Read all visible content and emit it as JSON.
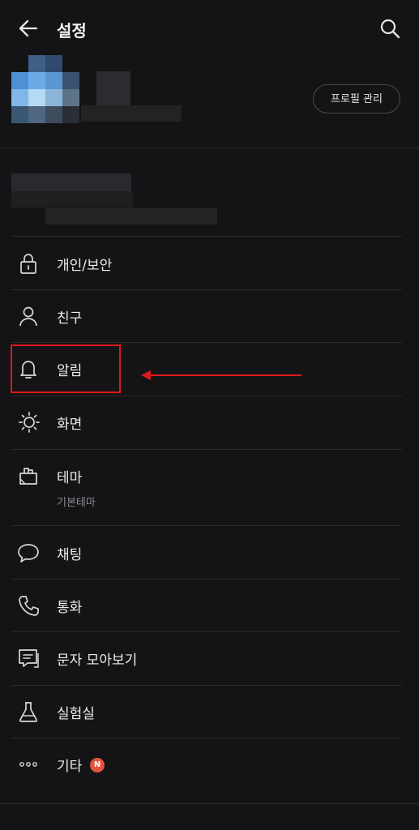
{
  "header": {
    "title": "설정"
  },
  "profile": {
    "manage_button": "프로필 관리"
  },
  "menu": {
    "items": [
      {
        "label": "개인/보안",
        "icon": "lock-icon"
      },
      {
        "label": "친구",
        "icon": "person-icon"
      },
      {
        "label": "알림",
        "icon": "bell-icon"
      },
      {
        "label": "화면",
        "icon": "brightness-icon"
      },
      {
        "label": "테마",
        "sub": "기본테마",
        "icon": "theme-icon"
      },
      {
        "label": "채팅",
        "icon": "chat-bubble-icon"
      },
      {
        "label": "통화",
        "icon": "phone-icon"
      },
      {
        "label": "문자 모아보기",
        "icon": "message-list-icon"
      },
      {
        "label": "실험실",
        "icon": "flask-icon"
      },
      {
        "label": "기타",
        "badge": "N",
        "icon": "more-dots-icon"
      }
    ]
  },
  "annotation": {
    "highlight_color": "#e0181b"
  }
}
